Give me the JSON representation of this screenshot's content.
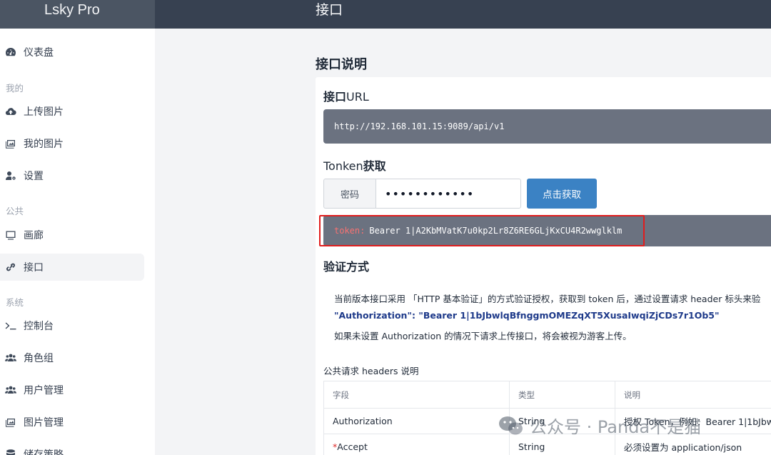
{
  "app": {
    "brand": "Lsky Pro",
    "page_title": "接口"
  },
  "sidebar": {
    "dashboard": "仪表盘",
    "section_mine": "我的",
    "upload": "上传图片",
    "my_images": "我的图片",
    "settings": "设置",
    "section_public": "公共",
    "gallery": "画廊",
    "api": "接口",
    "section_system": "系统",
    "console": "控制台",
    "roles": "角色组",
    "users": "用户管理",
    "images_admin": "图片管理",
    "storage": "储存策略"
  },
  "main": {
    "heading": "接口说明",
    "url_title_bold": "接口",
    "url_title_rest": "URL",
    "api_url": "http://192.168.101.15:9089/api/v1",
    "token_title_rest": "Tonken",
    "token_title_bold": "获取",
    "password_label": "密码",
    "password_value": "••••••••••••",
    "get_button": "点击获取",
    "token_key": "token:",
    "token_value": "Bearer 1|A2KbMVatK7u0kp2Lr8Z6RE6GLjKxCU4R2wwglklm",
    "auth_title": "验证方式",
    "auth_line1": "当前版本接口采用 「HTTP 基本验证」的方式验证授权，获取到 token 后，通过设置请求 header 标头来验",
    "auth_line2": "\"Authorization\": \"Bearer 1|1bJbwlqBfnggmOMEZqXT5XusaIwqiZjCDs7r1Ob5\"",
    "auth_line3": "如果未设置 Authorization 的情况下请求上传接口，将会被视为游客上传。",
    "headers_title": "公共请求 headers 说明",
    "table": {
      "columns": [
        "字段",
        "类型",
        "说明"
      ],
      "rows": [
        {
          "field": "Authorization",
          "required": "",
          "type": "String",
          "desc": "授权 Token，例如：Bearer 1|1bJbw"
        },
        {
          "field": "Accept",
          "required": "*",
          "type": "String",
          "desc": "必须设置为 application/json"
        }
      ]
    }
  },
  "watermark": "公众号 · Panda不是猫"
}
